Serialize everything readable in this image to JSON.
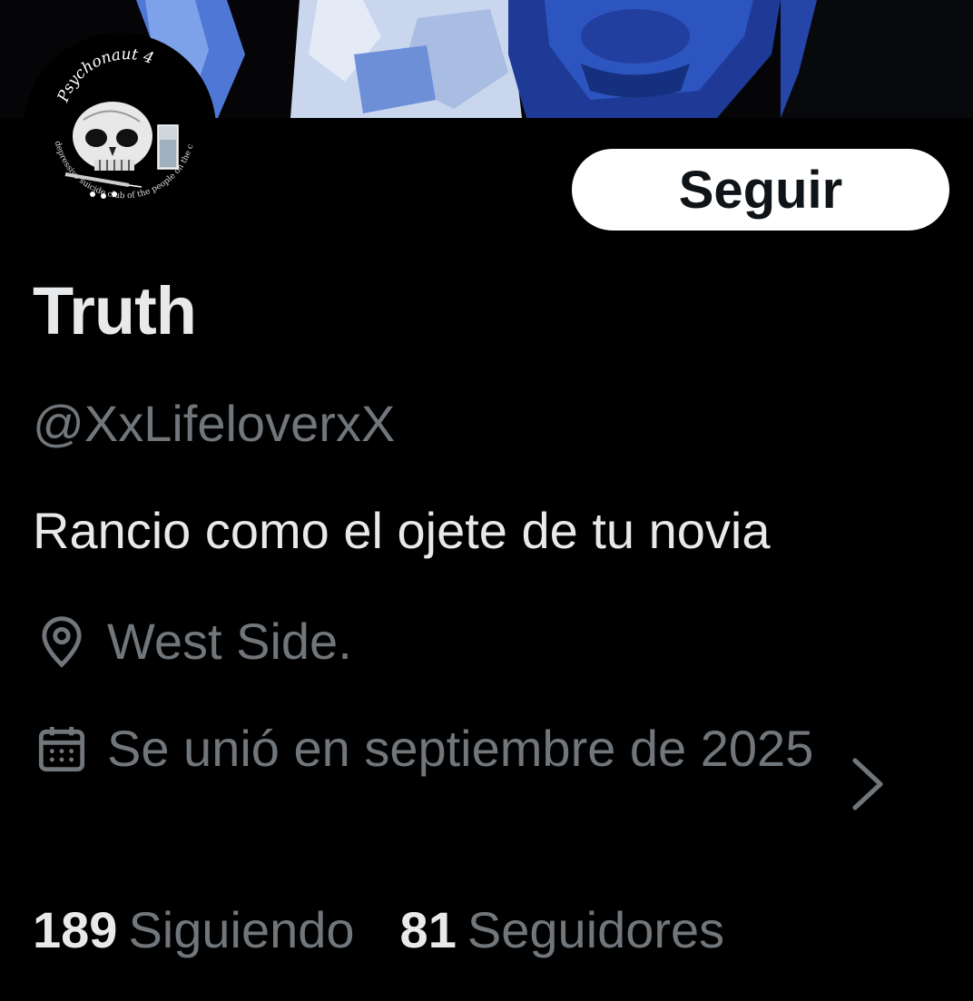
{
  "profile": {
    "display_name": "Truth",
    "handle": "@XxLifeloverxX",
    "bio": "Rancio como el ojete de tu novia",
    "location": "West Side.",
    "joined": "Se unió en septiembre de 2025",
    "follow_button_label": "Seguir",
    "following_count": "189",
    "following_label": "Siguiendo",
    "followers_count": "81",
    "followers_label": "Seguidores"
  },
  "avatar": {
    "logo_text": "Psychonaut 4",
    "logo_subtext": "depressive suicide club of the people on the chair"
  },
  "icons": {
    "location": "location-pin-icon",
    "joined": "calendar-icon",
    "chevron": "chevron-right-icon"
  },
  "colors": {
    "background": "#000000",
    "primary_text": "#e7e9ea",
    "secondary_text": "#71767b",
    "button_bg": "#ffffff",
    "button_text": "#0f1419",
    "banner_blue": "#3b63c8"
  }
}
